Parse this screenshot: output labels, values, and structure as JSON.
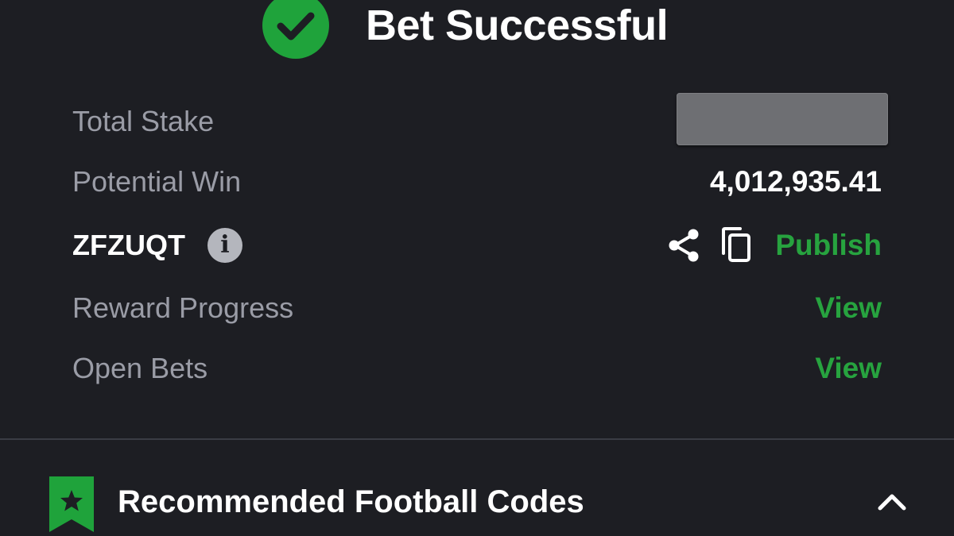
{
  "header": {
    "title": "Bet Successful",
    "status_icon": "check-circle-icon",
    "accent_color": "#1fa33b"
  },
  "rows": {
    "total_stake": {
      "label": "Total Stake",
      "value_redacted": true
    },
    "potential_win": {
      "label": "Potential Win",
      "value": "4,012,935.41"
    },
    "booking_code": {
      "code": "ZFZUQT",
      "info_icon": "info-icon",
      "share_icon": "share-icon",
      "copy_icon": "copy-icon",
      "publish_label": "Publish"
    },
    "reward_progress": {
      "label": "Reward Progress",
      "link": "View"
    },
    "open_bets": {
      "label": "Open Bets",
      "link": "View"
    }
  },
  "recommended": {
    "title": "Recommended Football Codes",
    "icon": "bookmark-star-icon",
    "toggle_icon": "chevron-up-icon"
  },
  "colors": {
    "background": "#1d1e23",
    "link_green": "#27a33f",
    "muted_text": "#9a9ca6"
  }
}
